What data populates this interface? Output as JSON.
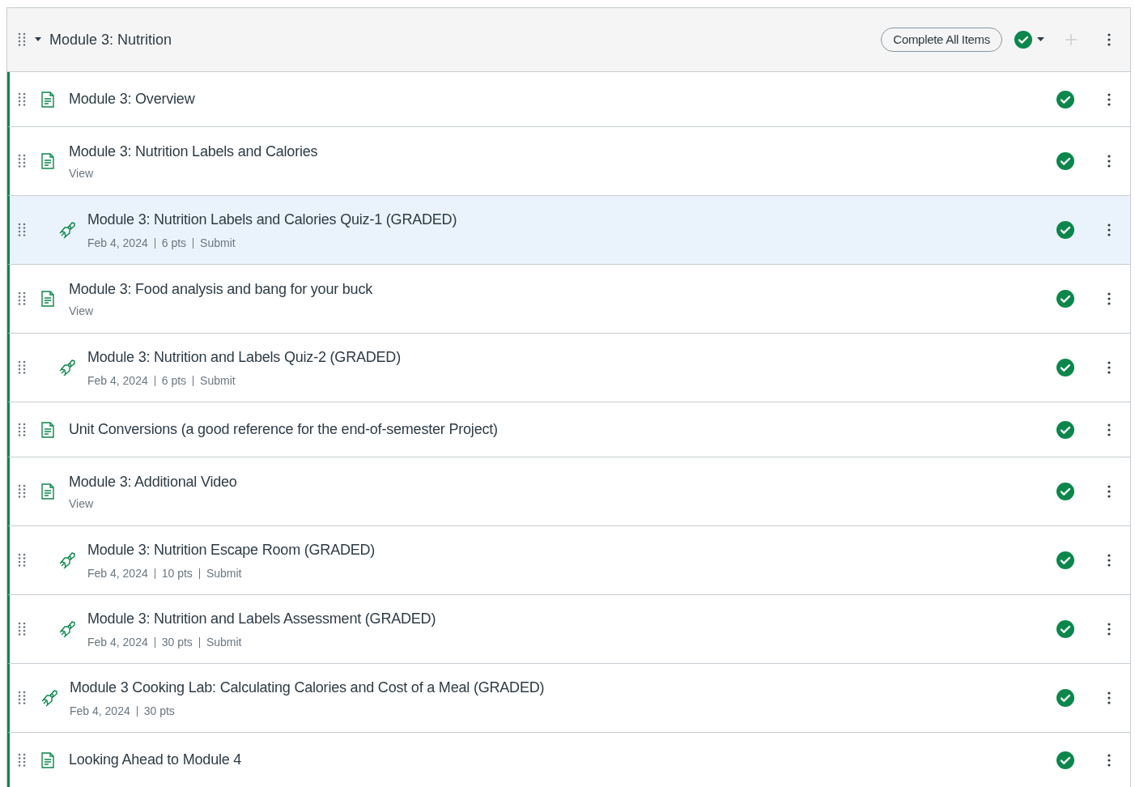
{
  "module": {
    "title": "Module 3: Nutrition",
    "expanded": true,
    "complete_button": "Complete All Items",
    "published": true
  },
  "items": [
    {
      "kind": "page",
      "title": "Module 3: Overview",
      "indented": false,
      "selected": false,
      "published": true
    },
    {
      "kind": "page",
      "title": "Module 3: Nutrition Labels and Calories",
      "subtitle": "View",
      "indented": false,
      "selected": false,
      "published": true
    },
    {
      "kind": "quiz",
      "title": "Module 3: Nutrition Labels and Calories Quiz-1 (GRADED)",
      "details": [
        "Feb 4, 2024",
        "6 pts",
        "Submit"
      ],
      "indented": true,
      "selected": true,
      "published": true
    },
    {
      "kind": "page",
      "title": "Module 3: Food analysis and bang for your buck",
      "subtitle": "View",
      "indented": false,
      "selected": false,
      "published": true
    },
    {
      "kind": "quiz",
      "title": "Module 3: Nutrition and Labels Quiz-2 (GRADED)",
      "details": [
        "Feb 4, 2024",
        "6 pts",
        "Submit"
      ],
      "indented": true,
      "selected": false,
      "published": true
    },
    {
      "kind": "page",
      "title": "Unit Conversions (a good reference for the end-of-semester Project)",
      "indented": false,
      "selected": false,
      "published": true
    },
    {
      "kind": "page",
      "title": "Module 3: Additional Video",
      "subtitle": "View",
      "indented": false,
      "selected": false,
      "published": true
    },
    {
      "kind": "quiz",
      "title": "Module 3: Nutrition Escape Room (GRADED)",
      "details": [
        "Feb 4, 2024",
        "10 pts",
        "Submit"
      ],
      "indented": true,
      "selected": false,
      "published": true
    },
    {
      "kind": "quiz",
      "title": "Module 3: Nutrition and Labels Assessment (GRADED)",
      "details": [
        "Feb 4, 2024",
        "30 pts",
        "Submit"
      ],
      "indented": true,
      "selected": false,
      "published": true
    },
    {
      "kind": "quiz",
      "title": "Module 3 Cooking Lab: Calculating Calories and Cost of a Meal (GRADED)",
      "details": [
        "Feb 4, 2024",
        "30 pts"
      ],
      "indented": false,
      "selected": false,
      "published": true
    },
    {
      "kind": "page",
      "title": "Looking Ahead to Module 4",
      "indented": false,
      "selected": false,
      "published": true
    }
  ]
}
